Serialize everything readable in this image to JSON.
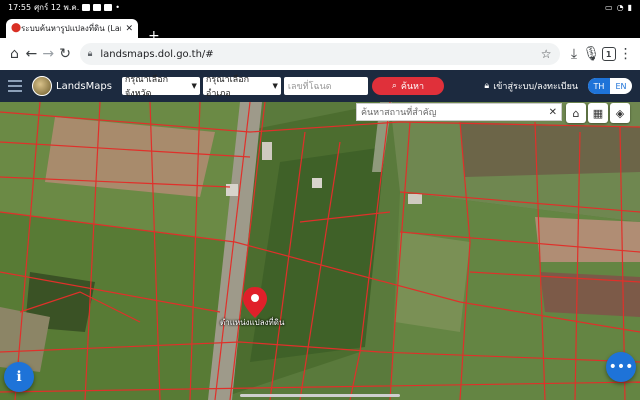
{
  "status_bar": {
    "time": "17:55",
    "date": "ศุกร์ 12 พ.ค."
  },
  "browser": {
    "tab_title": "ระบบค้นหารูปแปลงที่ดิน (Lands",
    "url": "landsmaps.dol.go.th/#",
    "tab_count": "1",
    "icons": [
      "home-icon",
      "back-icon",
      "forward-icon",
      "reload-icon",
      "lock-icon",
      "star-icon",
      "download-icon",
      "mic-icon",
      "tab-switcher-icon",
      "overflow-menu-icon"
    ]
  },
  "site_header": {
    "brand": "LandsMaps",
    "province_select": "กรุณาเลือกจังหวัด",
    "district_select": "กรุณาเลือกอำเภอ",
    "deed_placeholder": "เลขที่โฉนด",
    "search_button": "ค้นหา",
    "login_link": "เข้าสู่ระบบ/ลงทะเบียน",
    "lang_th": "TH",
    "lang_en": "EN"
  },
  "map": {
    "place_search_placeholder": "ค้นหาสถานที่สำคัญ",
    "pin_label": "ตำแหน่งแปลงที่ดิน",
    "colors": {
      "parcel_line": "#e0302a",
      "header_bg": "#1c2a3f",
      "accent": "#1e73d8",
      "search_red": "#e0303a"
    }
  }
}
